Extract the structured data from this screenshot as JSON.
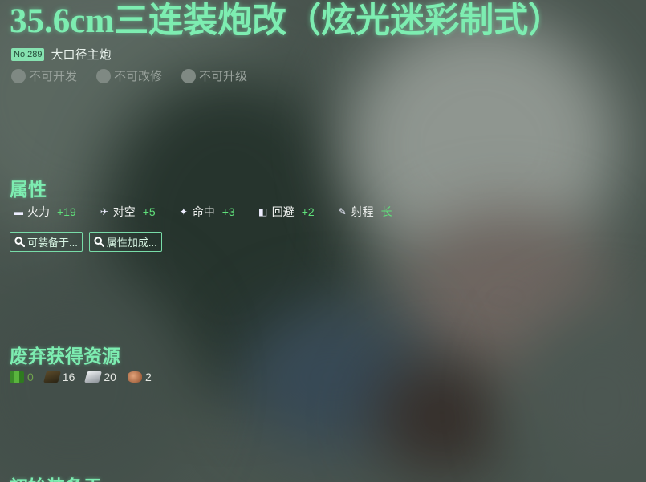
{
  "equipment": {
    "name": "35.6cm三连装炮改（炫光迷彩制式）",
    "number": "No.289",
    "type": "大口径主炮"
  },
  "flags": [
    {
      "label": "不可开发"
    },
    {
      "label": "不可改修"
    },
    {
      "label": "不可升级"
    }
  ],
  "sections": {
    "stats_title": "属性",
    "scrap_title": "废弃获得资源",
    "next_title": "初始装备于"
  },
  "stats": [
    {
      "icon": "firepower-icon",
      "name": "火力",
      "value": "+19"
    },
    {
      "icon": "anti-air-icon",
      "name": "对空",
      "value": "+5"
    },
    {
      "icon": "accuracy-icon",
      "name": "命中",
      "value": "+3"
    },
    {
      "icon": "evasion-icon",
      "name": "回避",
      "value": "+2"
    },
    {
      "icon": "range-icon",
      "name": "射程",
      "value": "长"
    }
  ],
  "buttons": {
    "equippable": "可装备于...",
    "bonus": "属性加成..."
  },
  "scrap": [
    {
      "icon": "fuel-icon",
      "value": "0"
    },
    {
      "icon": "ammo-icon",
      "value": "16"
    },
    {
      "icon": "steel-icon",
      "value": "20"
    },
    {
      "icon": "bauxite-icon",
      "value": "2"
    }
  ],
  "colors": {
    "accent": "#7dedb1",
    "stat_value": "#5fe07a"
  }
}
